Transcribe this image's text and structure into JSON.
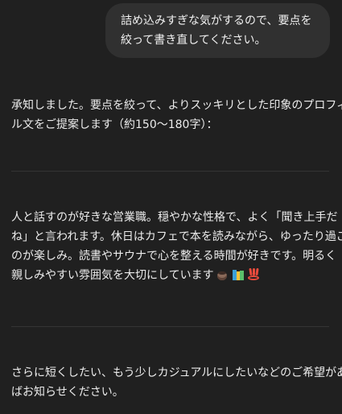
{
  "user_message": {
    "lines": [
      "詰め込みすぎな気がするので、要点を",
      "絞って書き直してください。"
    ]
  },
  "assistant": {
    "intro_lines": [
      "承知しました。要点を絞って、よりスッキリとした印象のプロフィー",
      "ル文をご提案します（約150〜180字）："
    ],
    "profile_lines": [
      "人と話すのが好きな営業職。穏やかな性格で、よく「聞き上手だ",
      "ね」と言われます。休日はカフェで本を読みながら、ゆったり過ごす",
      "のが楽しみ。読書やサウナで心を整える時間が好きです。明るく",
      "親しみやすい雰囲気を大切にしています"
    ],
    "profile_emojis": [
      "coffee-icon",
      "books-icon",
      "hot-springs-icon"
    ],
    "followup_lines": [
      "さらに短くしたい、もう少しカジュアルにしたいなどのご希望があれ",
      "ばお知らせください。"
    ]
  }
}
